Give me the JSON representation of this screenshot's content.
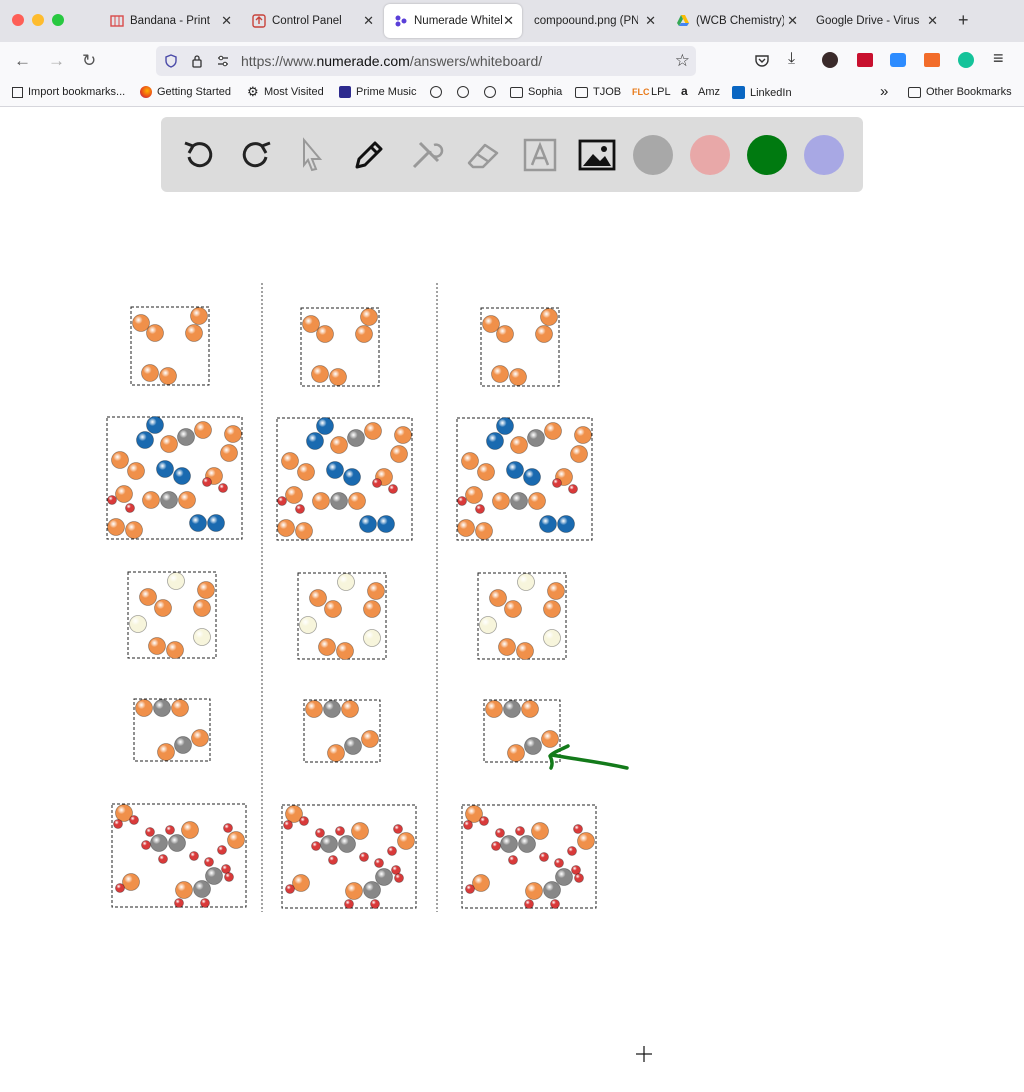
{
  "browser": {
    "tabs": [
      {
        "title": "Bandana - Print",
        "icon": "map-icon",
        "active": false
      },
      {
        "title": "Control Panel",
        "icon": "upload-icon",
        "active": false
      },
      {
        "title": "Numerade Whiteb",
        "icon": "numerade-icon",
        "active": true
      },
      {
        "title": "compoound.png (PNG",
        "icon": "",
        "active": false
      },
      {
        "title": "(WCB Chemistry)",
        "icon": "google-drive-icon",
        "active": false
      },
      {
        "title": "Google Drive - Virus",
        "icon": "",
        "active": false
      }
    ],
    "url_prefix": "https://www.",
    "url_domain": "numerade.com",
    "url_path": "/answers/whiteboard/",
    "bookmarks": [
      {
        "label": "Import bookmarks...",
        "icon": "import-icon"
      },
      {
        "label": "Getting Started",
        "icon": "firefox-icon"
      },
      {
        "label": "Most Visited",
        "icon": "gear-icon"
      },
      {
        "label": "Prime Music",
        "icon": "music-icon"
      },
      {
        "label": "",
        "icon": "globe-icon"
      },
      {
        "label": "",
        "icon": "globe-icon"
      },
      {
        "label": "",
        "icon": "globe-icon"
      },
      {
        "label": "Sophia",
        "icon": "folder-icon"
      },
      {
        "label": "TJOB",
        "icon": "folder-icon"
      },
      {
        "label": "LPL",
        "icon": "lpl-icon"
      },
      {
        "label": "Amz",
        "icon": "amazon-icon"
      },
      {
        "label": "LinkedIn",
        "icon": "linkedin-icon"
      }
    ],
    "other_bookmarks": "Other Bookmarks"
  },
  "toolbar": {
    "tools": [
      "undo-icon",
      "redo-icon",
      "cursor-icon",
      "pen-icon",
      "tools-icon",
      "eraser-icon",
      "text-icon",
      "image-icon"
    ],
    "colors": [
      "#a8a8a8",
      "#e8a8a8",
      "#007a10",
      "#a8a8e4"
    ]
  },
  "atom_colors": {
    "orange": "#f0904a",
    "blue": "#1a6ab0",
    "gray": "#888888",
    "red": "#d93a3a",
    "cream": "#f7f5dc"
  },
  "annotation_color": "#137a1a"
}
